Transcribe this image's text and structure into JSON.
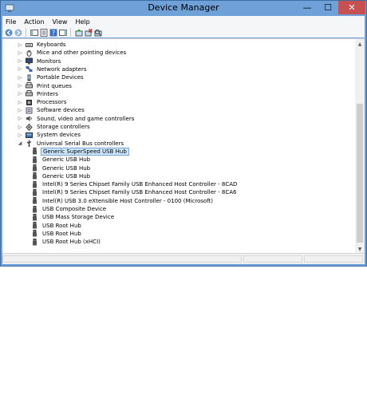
{
  "window": {
    "title": "Device Manager"
  },
  "controls": {
    "minimize": "—",
    "maximize": "☐",
    "close": "✕"
  },
  "menu": [
    "File",
    "Action",
    "View",
    "Help"
  ],
  "toolbar_icons": [
    "back-icon",
    "forward-icon",
    "show-hide-console-tree-icon",
    "properties-icon",
    "help-icon",
    "action-pane-icon",
    "monitor-icon",
    "update-driver-icon",
    "uninstall-icon",
    "scan-hardware-icon"
  ],
  "tree": [
    {
      "label": "Keyboards",
      "expander": "▷",
      "icon": "keyboard-icon"
    },
    {
      "label": "Mice and other pointing devices",
      "expander": "▷",
      "icon": "mouse-icon"
    },
    {
      "label": "Monitors",
      "expander": "▷",
      "icon": "monitor-icon"
    },
    {
      "label": "Network adapters",
      "expander": "▷",
      "icon": "network-icon"
    },
    {
      "label": "Portable Devices",
      "expander": "▷",
      "icon": "portable-device-icon"
    },
    {
      "label": "Print queues",
      "expander": "▷",
      "icon": "printer-icon"
    },
    {
      "label": "Printers",
      "expander": "▷",
      "icon": "printer-icon"
    },
    {
      "label": "Processors",
      "expander": "▷",
      "icon": "processor-icon"
    },
    {
      "label": "Software devices",
      "expander": "▷",
      "icon": "software-device-icon"
    },
    {
      "label": "Sound, video and game controllers",
      "expander": "▷",
      "icon": "sound-icon"
    },
    {
      "label": "Storage controllers",
      "expander": "▷",
      "icon": "storage-icon"
    },
    {
      "label": "System devices",
      "expander": "▷",
      "icon": "system-device-icon"
    },
    {
      "label": "Universal Serial Bus controllers",
      "expander": "◢",
      "icon": "usb-icon"
    },
    {
      "label": "Generic SuperSpeed USB Hub",
      "expander": "",
      "icon": "usb-plug-icon",
      "selected": true
    },
    {
      "label": "Generic USB Hub",
      "expander": "",
      "icon": "usb-plug-icon"
    },
    {
      "label": "Generic USB Hub",
      "expander": "",
      "icon": "usb-plug-icon"
    },
    {
      "label": "Generic USB Hub",
      "expander": "",
      "icon": "usb-plug-icon"
    },
    {
      "label": "Intel(R) 9 Series Chipset Family USB Enhanced Host Controller  - 8CAD",
      "expander": "",
      "icon": "usb-plug-icon"
    },
    {
      "label": "Intel(R) 9 Series Chipset Family USB Enhanced Host Controller  - 8CA6",
      "expander": "",
      "icon": "usb-plug-icon"
    },
    {
      "label": "Intel(R) USB 3.0 eXtensible Host Controller - 0100 (Microsoft)",
      "expander": "",
      "icon": "usb-plug-icon"
    },
    {
      "label": "USB Composite Device",
      "expander": "",
      "icon": "usb-plug-icon"
    },
    {
      "label": "USB Mass Storage Device",
      "expander": "",
      "icon": "usb-plug-icon"
    },
    {
      "label": "USB Root Hub",
      "expander": "",
      "icon": "usb-plug-icon"
    },
    {
      "label": "USB Root Hub",
      "expander": "",
      "icon": "usb-plug-icon"
    },
    {
      "label": "USB Root Hub (xHCI)",
      "expander": "",
      "icon": "usb-plug-icon"
    }
  ],
  "colors": {
    "titlebar": "#6fa0d8",
    "close": "#c75050",
    "selection": "#cce8ff"
  }
}
